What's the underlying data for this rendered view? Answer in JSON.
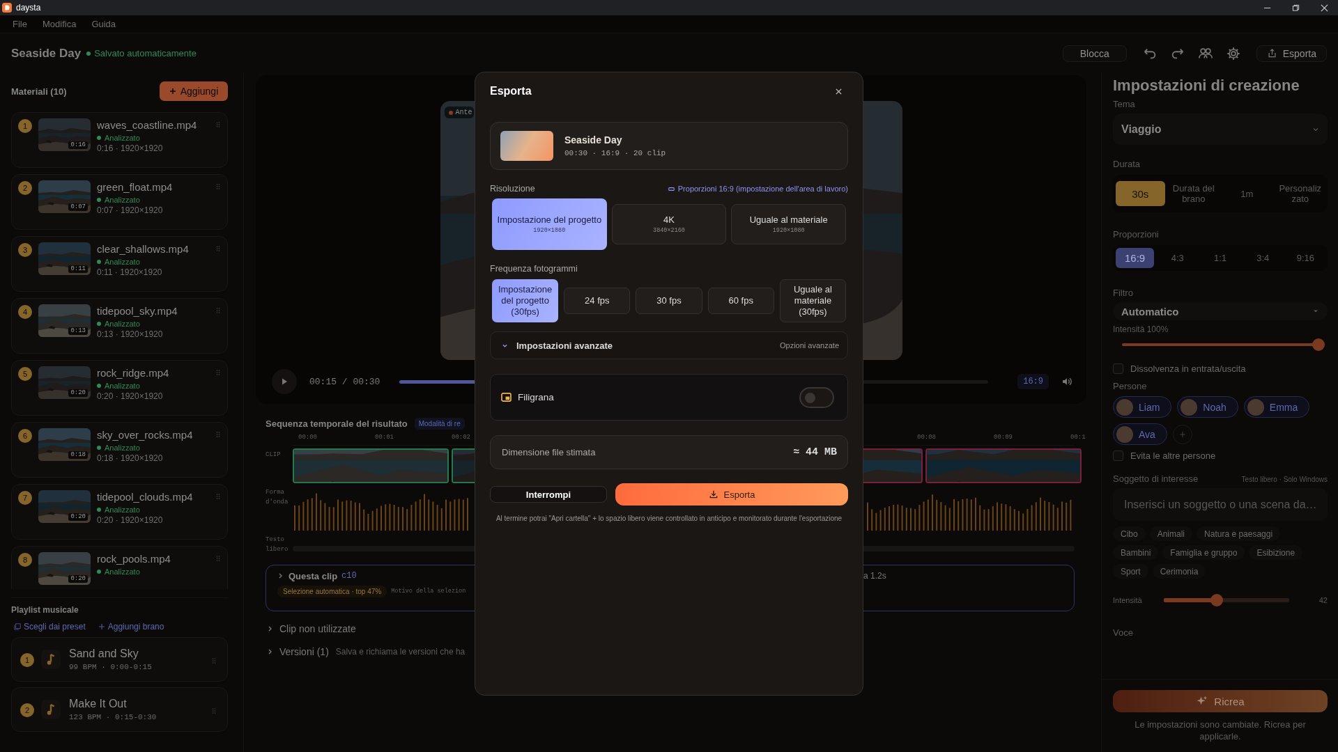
{
  "window": {
    "title": "daysta"
  },
  "menu": [
    "File",
    "Modifica",
    "Guida"
  ],
  "project": {
    "title": "Seaside Day",
    "save_status": "Salvato automaticamente"
  },
  "toolbar": {
    "lock_button": "Blocca",
    "export_button": "Esporta"
  },
  "materials": {
    "title": "Materiali (10)",
    "add_button": "Aggiungi",
    "items": [
      {
        "index": "1",
        "name": "waves_coastline.mp4",
        "duration": "0:16",
        "status": "Analizzato",
        "meta": "0:16 · 1920×1920"
      },
      {
        "index": "2",
        "name": "green_float.mp4",
        "duration": "0:07",
        "status": "Analizzato",
        "meta": "0:07 · 1920×1920"
      },
      {
        "index": "3",
        "name": "clear_shallows.mp4",
        "duration": "0:11",
        "status": "Analizzato",
        "meta": "0:11 · 1920×1920"
      },
      {
        "index": "4",
        "name": "tidepool_sky.mp4",
        "duration": "0:13",
        "status": "Analizzato",
        "meta": "0:13 · 1920×1920"
      },
      {
        "index": "5",
        "name": "rock_ridge.mp4",
        "duration": "0:20",
        "status": "Analizzato",
        "meta": "0:20 · 1920×1920"
      },
      {
        "index": "6",
        "name": "sky_over_rocks.mp4",
        "duration": "0:18",
        "status": "Analizzato",
        "meta": "0:18 · 1920×1920"
      },
      {
        "index": "7",
        "name": "tidepool_clouds.mp4",
        "duration": "0:20",
        "status": "Analizzato",
        "meta": "0:20 · 1920×1920"
      },
      {
        "index": "8",
        "name": "rock_pools.mp4",
        "duration": "0:20",
        "status": "Analizzato"
      }
    ]
  },
  "playlist": {
    "title": "Playlist musicale",
    "preset_link": "Scegli dai preset",
    "add_link": "Aggiungi brano",
    "tracks": [
      {
        "index": "1",
        "name": "Sand and Sky",
        "meta": "99 BPM · 0:00-0:15"
      },
      {
        "index": "2",
        "name": "Make It Out",
        "meta": "123 BPM · 0:15-0:30"
      }
    ]
  },
  "preview": {
    "badge": "Ante",
    "time": "00:15 / 00:30",
    "level": 0.5,
    "aspect": "16:9"
  },
  "timeline": {
    "title": "Sequenza temporale del risultato",
    "mode_badge": "Modalità di re",
    "ruler": [
      "00:00",
      "00:01",
      "00:02",
      "00:08",
      "00:09",
      "00:1"
    ],
    "row_labels": [
      "CLIP",
      "Forma d'onda",
      "Testo libero"
    ],
    "clips": [
      {
        "color": "#237a4c"
      },
      {
        "color": "#237a4c"
      },
      {
        "color": "#7a1f3c"
      },
      {
        "color": "#7a1f3c"
      }
    ],
    "clip_card": {
      "title": "Questa clip",
      "clip_id": "c10",
      "badge": "Selezione automatica · top 47%",
      "reason": "Motivo della selezion",
      "trailing": "a 1.2s"
    },
    "unused": "Clip non utilizzate",
    "versions": {
      "title": "Versioni (1)",
      "hint": "Salva e richiama le versioni che ha"
    }
  },
  "settings": {
    "title": "Impostazioni di creazione",
    "theme": {
      "label": "Tema",
      "value": "Viaggio"
    },
    "duration": {
      "label": "Durata",
      "options": [
        {
          "label": "30s",
          "selected": true
        },
        {
          "label": "Durata del brano",
          "selected": false
        },
        {
          "label": "1m",
          "selected": false
        },
        {
          "label": "Personalizzato",
          "selected": false
        }
      ]
    },
    "aspect": {
      "label": "Proporzioni",
      "options": [
        {
          "label": "16:9",
          "selected": true
        },
        {
          "label": "4:3",
          "selected": false
        },
        {
          "label": "1:1",
          "selected": false
        },
        {
          "label": "3:4",
          "selected": false
        },
        {
          "label": "9:16",
          "selected": false
        }
      ]
    },
    "filter": {
      "label": "Filtro",
      "value": "Automatico",
      "intensity_label": "Intensità 100%",
      "level": 1
    },
    "fade": {
      "label": "Dissolvenza in entrata/uscita",
      "checked": false
    },
    "people": {
      "label": "Persone",
      "items": [
        {
          "name": "Liam"
        },
        {
          "name": "Noah"
        },
        {
          "name": "Emma"
        },
        {
          "name": "Ava"
        }
      ]
    },
    "avoid_others": {
      "label": "Evita le altre persone",
      "checked": false
    },
    "subject": {
      "label": "Soggetto di interesse",
      "hint": "Testo libero · Solo Windows",
      "placeholder": "Inserisci un soggetto o una scena da…",
      "tags": [
        "Cibo",
        "Animali",
        "Natura e paesaggi",
        "Bambini",
        "Famiglia e gruppo",
        "Esibizione",
        "Sport",
        "Cerimonia"
      ]
    },
    "intensity": {
      "label": "Intensità",
      "level": 0.42,
      "reading": "42"
    },
    "voice": {
      "label": "Voce"
    },
    "recreate_button": "Ricrea",
    "note": "Le impostazioni sono cambiate. Ricrea per applicarle."
  },
  "export_dialog": {
    "title": "Esporta",
    "project": {
      "name": "Seaside Day",
      "meta": "00:30 · 16:9 · 20 clip"
    },
    "resolution": {
      "label": "Risoluzione",
      "link": "Proporzioni 16:9 (impostazione dell'area di lavoro)",
      "options": [
        {
          "label": "Impostazione del progetto",
          "detail": "1920×1080",
          "selected": true
        },
        {
          "label": "4K",
          "detail": "3840×2160",
          "selected": false
        },
        {
          "label": "Uguale al materiale",
          "detail": "1920×1080",
          "selected": false
        }
      ]
    },
    "frame_rate": {
      "label": "Frequenza fotogrammi",
      "options": [
        {
          "label": "Impostazione del progetto (30fps)",
          "selected": true
        },
        {
          "label": "24 fps",
          "selected": false
        },
        {
          "label": "30 fps",
          "selected": false
        },
        {
          "label": "60 fps",
          "selected": false
        },
        {
          "label": "Uguale al materiale (30fps)",
          "selected": false
        }
      ]
    },
    "advanced": {
      "label": "Impostazioni avanzate",
      "hint": "Opzioni avanzate"
    },
    "watermark": {
      "label": "Filigrana",
      "on": false
    },
    "file_size": {
      "label": "Dimensione file stimata",
      "value": "≈ 44 MB"
    },
    "cancel_button": "Interrompi",
    "export_button": "Esporta",
    "note": "Al termine potrai \"Apri cartella\" + lo spazio libero viene controllato in anticipo e monitorato durante l'esportazione"
  }
}
